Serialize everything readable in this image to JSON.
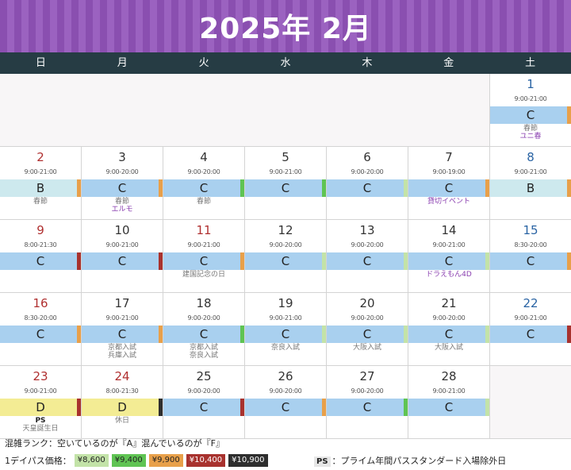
{
  "header": {
    "title": "2025年 2月"
  },
  "weekdays": [
    "日",
    "月",
    "火",
    "水",
    "木",
    "金",
    "土"
  ],
  "rank_colors": {
    "B": "#cde9ee",
    "C": "#a9d0ef",
    "D": "#f3ec94"
  },
  "weeks": [
    [
      null,
      null,
      null,
      null,
      null,
      null,
      {
        "day": "1",
        "type": "sat",
        "hours": "9:00-21:00",
        "rank": "C",
        "strip": "#e8a04a",
        "notes": [
          {
            "text": "春節",
            "style": "plain"
          },
          {
            "text": "ユニ春",
            "style": "link"
          }
        ]
      }
    ],
    [
      {
        "day": "2",
        "type": "sun",
        "hours": "9:00-21:00",
        "rank": "B",
        "strip": "#e8a04a",
        "notes": [
          {
            "text": "春節",
            "style": "plain"
          }
        ]
      },
      {
        "day": "3",
        "type": "wd",
        "hours": "9:00-20:00",
        "rank": "C",
        "strip": "#e8a04a",
        "notes": [
          {
            "text": "春節",
            "style": "plain"
          },
          {
            "text": "エルモ",
            "style": "link"
          }
        ]
      },
      {
        "day": "4",
        "type": "wd",
        "hours": "9:00-20:00",
        "rank": "C",
        "strip": "#5fc453",
        "notes": [
          {
            "text": "春節",
            "style": "plain"
          }
        ]
      },
      {
        "day": "5",
        "type": "wd",
        "hours": "9:00-21:00",
        "rank": "C",
        "strip": "#5fc453",
        "notes": []
      },
      {
        "day": "6",
        "type": "wd",
        "hours": "9:00-20:00",
        "rank": "C",
        "strip": "#c3e3a8",
        "notes": []
      },
      {
        "day": "7",
        "type": "wd",
        "hours": "9:00-19:00",
        "rank": "C",
        "strip": "#e8a04a",
        "notes": [
          {
            "text": "貸切イベント",
            "style": "link"
          }
        ]
      },
      {
        "day": "8",
        "type": "sat",
        "hours": "9:00-21:00",
        "rank": "B",
        "strip": "#e8a04a",
        "notes": []
      }
    ],
    [
      {
        "day": "9",
        "type": "sun",
        "hours": "8:00-21:30",
        "rank": "C",
        "strip": "#a8322e",
        "notes": []
      },
      {
        "day": "10",
        "type": "wd",
        "hours": "9:00-21:00",
        "rank": "C",
        "strip": "#a8322e",
        "notes": []
      },
      {
        "day": "11",
        "type": "hol",
        "hours": "9:00-21:00",
        "rank": "C",
        "strip": "#e8a04a",
        "notes": [
          {
            "text": "建国記念の日",
            "style": "plain"
          }
        ]
      },
      {
        "day": "12",
        "type": "wd",
        "hours": "9:00-20:00",
        "rank": "C",
        "strip": "#c3e3a8",
        "notes": []
      },
      {
        "day": "13",
        "type": "wd",
        "hours": "9:00-20:00",
        "rank": "C",
        "strip": "#c3e3a8",
        "notes": []
      },
      {
        "day": "14",
        "type": "wd",
        "hours": "9:00-21:00",
        "rank": "C",
        "strip": "#c3e3a8",
        "notes": [
          {
            "text": "ドラえもん4D",
            "style": "link"
          }
        ]
      },
      {
        "day": "15",
        "type": "sat",
        "hours": "8:30-20:00",
        "rank": "C",
        "strip": "#e8a04a",
        "notes": []
      }
    ],
    [
      {
        "day": "16",
        "type": "sun",
        "hours": "8:30-20:00",
        "rank": "C",
        "strip": "#e8a04a",
        "notes": []
      },
      {
        "day": "17",
        "type": "wd",
        "hours": "9:00-21:00",
        "rank": "C",
        "strip": "#e8a04a",
        "notes": [
          {
            "text": "京都入試",
            "style": "plain"
          },
          {
            "text": "兵庫入試",
            "style": "plain"
          }
        ]
      },
      {
        "day": "18",
        "type": "wd",
        "hours": "9:00-20:00",
        "rank": "C",
        "strip": "#5fc453",
        "notes": [
          {
            "text": "京都入試",
            "style": "plain"
          },
          {
            "text": "奈良入試",
            "style": "plain"
          }
        ]
      },
      {
        "day": "19",
        "type": "wd",
        "hours": "9:00-21:00",
        "rank": "C",
        "strip": "#c3e3a8",
        "notes": [
          {
            "text": "奈良入試",
            "style": "plain"
          }
        ]
      },
      {
        "day": "20",
        "type": "wd",
        "hours": "9:00-20:00",
        "rank": "C",
        "strip": "#c3e3a8",
        "notes": [
          {
            "text": "大阪入試",
            "style": "plain"
          }
        ]
      },
      {
        "day": "21",
        "type": "wd",
        "hours": "9:00-20:00",
        "rank": "C",
        "strip": "#c3e3a8",
        "notes": [
          {
            "text": "大阪入試",
            "style": "plain"
          }
        ]
      },
      {
        "day": "22",
        "type": "sat",
        "hours": "9:00-21:00",
        "rank": "C",
        "strip": "#a8322e",
        "notes": []
      }
    ],
    [
      {
        "day": "23",
        "type": "sun",
        "hours": "9:00-21:00",
        "rank": "D",
        "strip": "#a8322e",
        "notes": [
          {
            "text": "PS",
            "style": "dark"
          },
          {
            "text": "天皇誕生日",
            "style": "plain"
          }
        ]
      },
      {
        "day": "24",
        "type": "hol",
        "hours": "8:00-21:30",
        "rank": "D",
        "strip": "#2e2e2e",
        "notes": [
          {
            "text": "休日",
            "style": "plain"
          }
        ]
      },
      {
        "day": "25",
        "type": "wd",
        "hours": "9:00-20:00",
        "rank": "C",
        "strip": "#a8322e",
        "notes": []
      },
      {
        "day": "26",
        "type": "wd",
        "hours": "9:00-20:00",
        "rank": "C",
        "strip": "#e8a04a",
        "notes": []
      },
      {
        "day": "27",
        "type": "wd",
        "hours": "9:00-20:00",
        "rank": "C",
        "strip": "#5fc453",
        "notes": []
      },
      {
        "day": "28",
        "type": "wd",
        "hours": "9:00-21:00",
        "rank": "C",
        "strip": "#c3e3a8",
        "notes": []
      },
      null
    ]
  ],
  "legend": {
    "rank_text": "混雑ランク：空いているのが『A』混んでいるのが『F』",
    "price_label": "1デイパス価格：",
    "prices": [
      {
        "label": "¥8,600",
        "bg": "#c3e3a8",
        "fg": "#222222"
      },
      {
        "label": "¥9,400",
        "bg": "#5fc453",
        "fg": "#222222"
      },
      {
        "label": "¥9,900",
        "bg": "#e8a04a",
        "fg": "#222222"
      },
      {
        "label": "¥10,400",
        "bg": "#a8322e",
        "fg": "#ffffff"
      },
      {
        "label": "¥10,900",
        "bg": "#2e2e2e",
        "fg": "#ffffff"
      }
    ],
    "ps_badge": "PS",
    "ps_text": "：プライム年間パススタンダード入場除外日"
  }
}
